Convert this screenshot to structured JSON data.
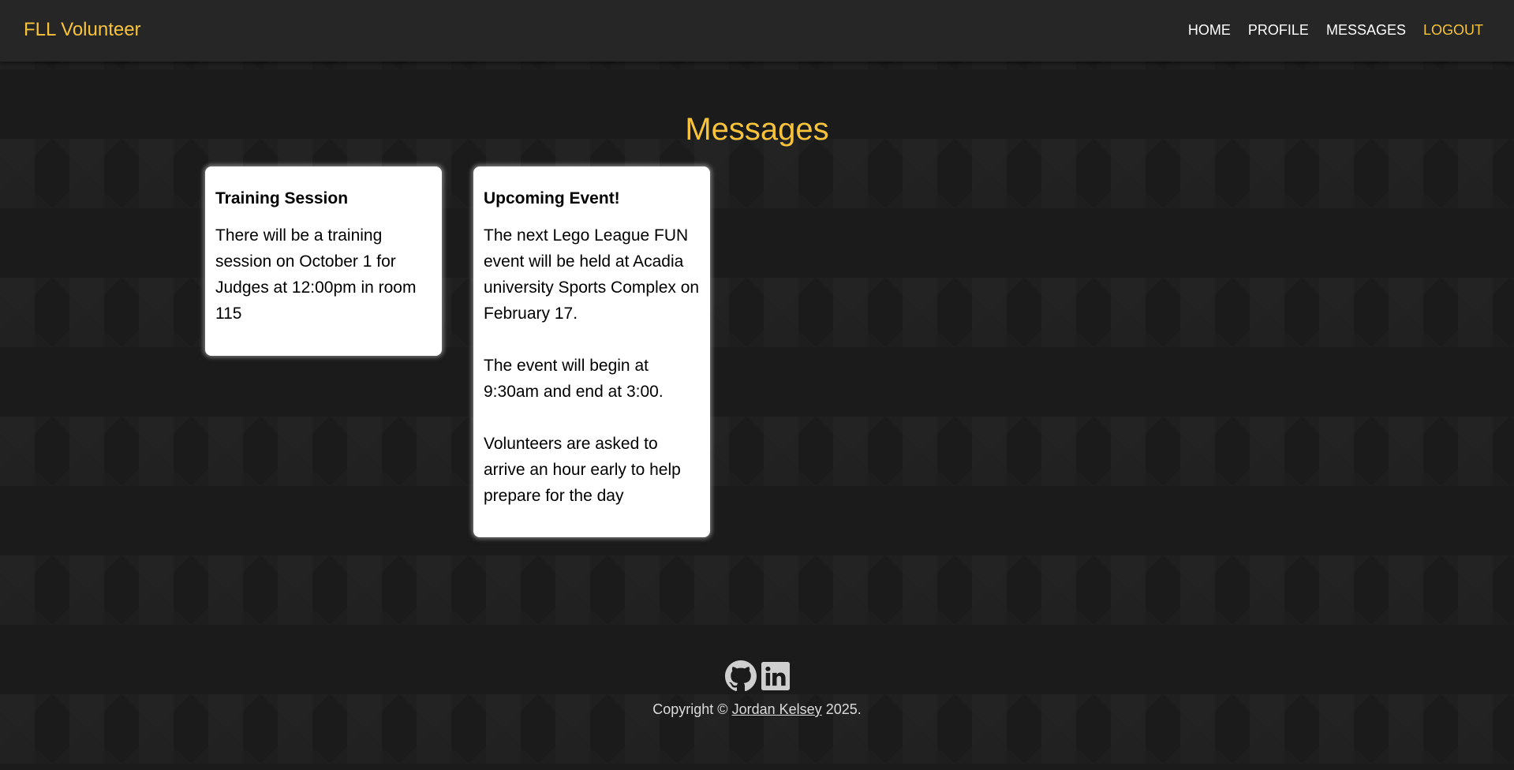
{
  "nav": {
    "brand": "FLL Volunteer",
    "links": [
      {
        "label": "HOME"
      },
      {
        "label": "PROFILE"
      },
      {
        "label": "MESSAGES"
      },
      {
        "label": "LOGOUT"
      }
    ]
  },
  "page": {
    "title": "Messages"
  },
  "messages": [
    {
      "title": "Training Session",
      "paragraphs": [
        "There will be a training session on October 1 for Judges at 12:00pm in room 115"
      ]
    },
    {
      "title": "Upcoming Event!",
      "paragraphs": [
        "The next Lego League FUN event will be held at Acadia university Sports Complex on February 17.",
        "The event will begin at 9:30am and end at 3:00.",
        "Volunteers are asked to arrive an hour early to help prepare for the day"
      ]
    }
  ],
  "footer": {
    "icons": [
      "github-icon",
      "linkedin-icon"
    ],
    "copyright_prefix": "Copyright ©",
    "author": "Jordan Kelsey",
    "copyright_suffix": "2025."
  },
  "colors": {
    "accent": "#f7c33c",
    "background": "#1b1b1b",
    "navbar": "#262626",
    "card": "#ffffff"
  }
}
